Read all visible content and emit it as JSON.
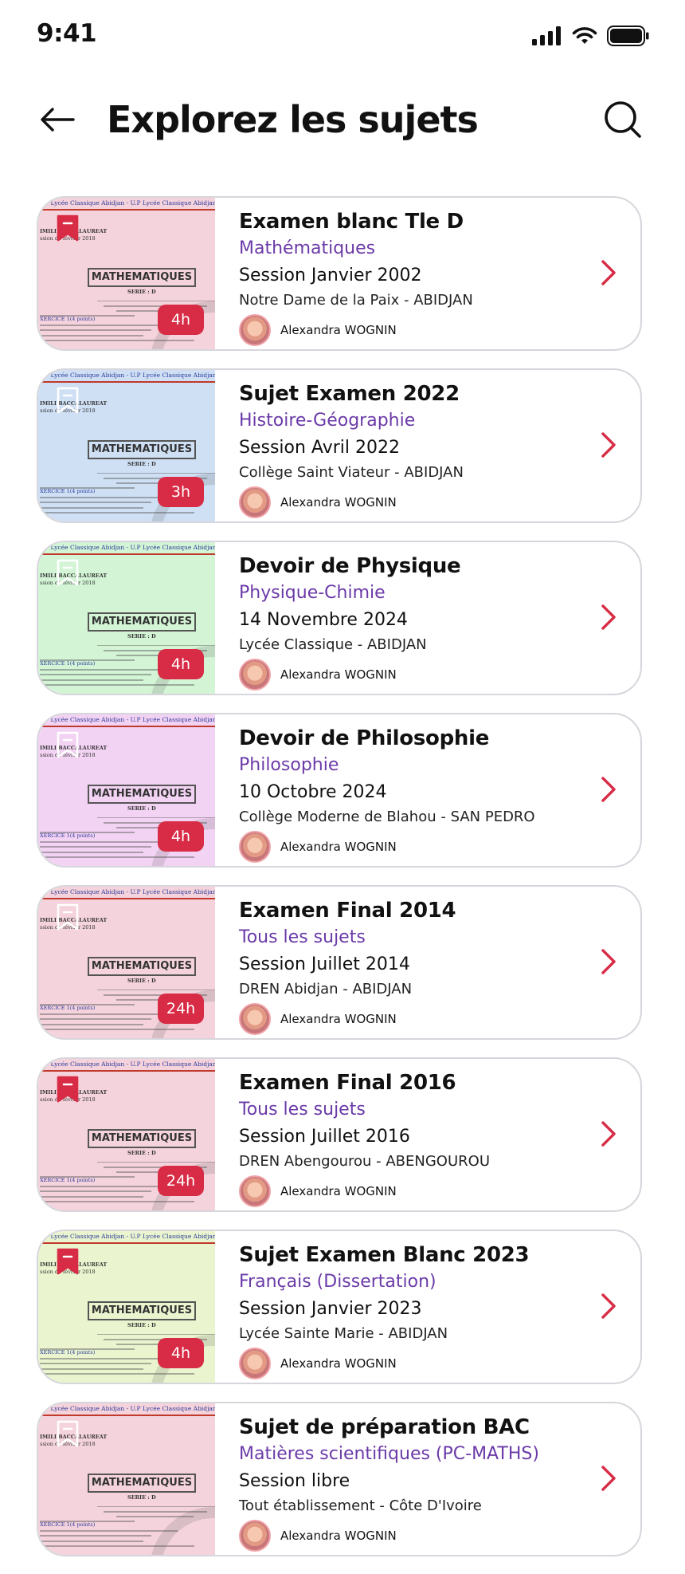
{
  "status": {
    "time": "9:41"
  },
  "header": {
    "title": "Explorez les sujets",
    "back_icon": "arrow-left-icon",
    "search_icon": "search-icon"
  },
  "doc_preview": {
    "school_header": "U.P Lycée Classique Abidjan - U.P Lycée Classique Abidjan - U.P Lycée",
    "exam_line1": "IMILI BACCALAUREAT",
    "exam_line2": "ssion de février 2018",
    "subject": "MATHEMATIQUES",
    "serie": "SERIE : D",
    "exercise": "XERCICE  1(4 points)"
  },
  "colors": {
    "accent": "#d82b45",
    "subject": "#6b3aa8",
    "border": "#d6d6dc"
  },
  "cards": [
    {
      "title": "Examen blanc Tle D",
      "subject": "Mathématiques",
      "session": "Session Janvier 2002",
      "school": "Notre Dame de la Paix - ABIDJAN",
      "author": "Alexandra WOGNIN",
      "duration": "4h",
      "bookmarked": true,
      "thumb_color": "#f5d3dc"
    },
    {
      "title": "Sujet Examen 2022",
      "subject": "Histoire-Géographie",
      "session": "Session Avril 2022",
      "school": "Collège Saint Viateur - ABIDJAN",
      "author": "Alexandra WOGNIN",
      "duration": "3h",
      "bookmarked": false,
      "thumb_color": "#cfe0f5"
    },
    {
      "title": "Devoir de Physique",
      "subject": "Physique-Chimie",
      "session": "14 Novembre 2024",
      "school": "Lycée Classique - ABIDJAN",
      "author": "Alexandra WOGNIN",
      "duration": "4h",
      "bookmarked": false,
      "thumb_color": "#d3f5d6"
    },
    {
      "title": "Devoir de Philosophie",
      "subject": "Philosophie",
      "session": "10 Octobre 2024",
      "school": "Collège Moderne de Blahou - SAN PEDRO",
      "author": "Alexandra WOGNIN",
      "duration": "4h",
      "bookmarked": false,
      "thumb_color": "#f3d3f3"
    },
    {
      "title": "Examen Final 2014",
      "subject": "Tous les sujets",
      "session": "Session Juillet 2014",
      "school": "DREN Abidjan - ABIDJAN",
      "author": "Alexandra WOGNIN",
      "duration": "24h",
      "bookmarked": false,
      "thumb_color": "#f5d3dc"
    },
    {
      "title": "Examen Final 2016",
      "subject": "Tous les sujets",
      "session": "Session Juillet 2016",
      "school": "DREN Abengourou - ABENGOUROU",
      "author": "Alexandra WOGNIN",
      "duration": "24h",
      "bookmarked": true,
      "thumb_color": "#f5d3dc"
    },
    {
      "title": "Sujet Examen Blanc 2023",
      "subject": "Français (Dissertation)",
      "session": "Session Janvier 2023",
      "school": "Lycée Sainte Marie - ABIDJAN",
      "author": "Alexandra WOGNIN",
      "duration": "4h",
      "bookmarked": true,
      "thumb_color": "#eaf5cf"
    },
    {
      "title": "Sujet de préparation BAC",
      "subject": "Matières scientifiques (PC-MATHS)",
      "session": "Session libre",
      "school": "Tout établissement - Côte D'Ivoire",
      "author": "Alexandra WOGNIN",
      "duration": "",
      "bookmarked": false,
      "thumb_color": "#f5d3dc"
    }
  ]
}
